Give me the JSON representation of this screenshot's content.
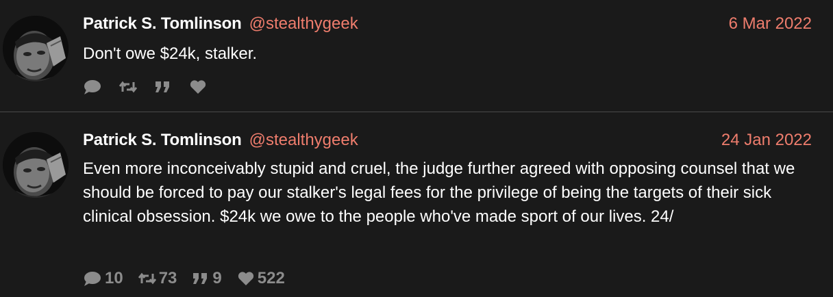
{
  "tweets": [
    {
      "author_name": "Patrick S. Tomlinson",
      "handle": "@stealthygeek",
      "date": "6 Mar 2022",
      "text": "Don't owe $24k, stalker.",
      "replies": "",
      "retweets": "",
      "quotes": "",
      "likes": ""
    },
    {
      "author_name": "Patrick S. Tomlinson",
      "handle": "@stealthygeek",
      "date": "24 Jan 2022",
      "text": "Even more inconceivably stupid and cruel, the judge further agreed with opposing counsel that we should be forced to pay our stalker's legal fees for the privilege of being the targets of their sick clinical obsession. $24k we owe to the people who've made sport of our lives. 24/",
      "replies": "10",
      "retweets": "73",
      "quotes": "9",
      "likes": "522"
    }
  ],
  "icons": {
    "reply": "speech-bubble-icon",
    "retweet": "retweet-arrows-icon",
    "quote": "quote-marks-icon",
    "like": "heart-icon"
  },
  "colors": {
    "background": "#1a1a1a",
    "accent": "#ef7d6d",
    "muted": "#8c8c8c",
    "divider": "#4a4a4a"
  }
}
